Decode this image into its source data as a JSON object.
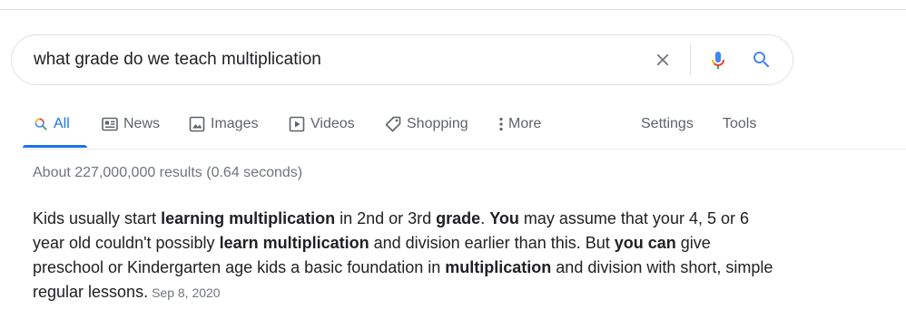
{
  "search": {
    "query": "what grade do we teach multiplication",
    "clear_icon": "close-icon",
    "mic_icon": "microphone-icon",
    "search_icon": "search-icon"
  },
  "tabs": [
    {
      "label": "All",
      "icon": "search-icon",
      "active": true
    },
    {
      "label": "News",
      "icon": "news-icon"
    },
    {
      "label": "Images",
      "icon": "image-icon"
    },
    {
      "label": "Videos",
      "icon": "video-play-icon"
    },
    {
      "label": "Shopping",
      "icon": "tag-icon"
    },
    {
      "label": "More",
      "icon": "more-vertical-icon"
    }
  ],
  "tools": {
    "settings": "Settings",
    "tools": "Tools"
  },
  "results": {
    "stats": "About 227,000,000 results (0.64 seconds)"
  },
  "snippet": {
    "parts": [
      {
        "text": "Kids usually start ",
        "bold": false
      },
      {
        "text": "learning multiplication",
        "bold": true
      },
      {
        "text": " in 2nd or 3rd ",
        "bold": false
      },
      {
        "text": "grade",
        "bold": true
      },
      {
        "text": ". ",
        "bold": false
      },
      {
        "text": "You",
        "bold": true
      },
      {
        "text": " may assume that your 4, 5 or 6 year old couldn't possibly ",
        "bold": false
      },
      {
        "text": "learn multiplication",
        "bold": true
      },
      {
        "text": " and division earlier than this. But ",
        "bold": false
      },
      {
        "text": "you can",
        "bold": true
      },
      {
        "text": " give preschool or Kindergarten age kids a basic foundation in ",
        "bold": false
      },
      {
        "text": "multiplication",
        "bold": true
      },
      {
        "text": " and division with short, simple regular lessons.",
        "bold": false
      }
    ],
    "date": "Sep 8, 2020"
  },
  "colors": {
    "accent": "#1a73e8",
    "text": "#202124",
    "muted": "#5f6368",
    "google_blue": "#4285f4",
    "google_red": "#ea4335",
    "google_yellow": "#fbbc05",
    "google_green": "#34a853"
  }
}
